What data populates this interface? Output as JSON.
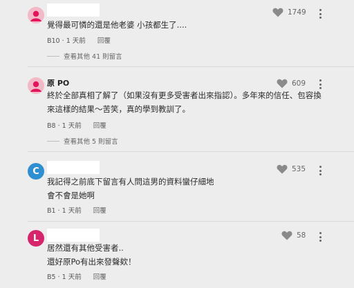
{
  "comments": [
    {
      "name": "",
      "text_lines": [
        "覺得最可憐的還是他老婆 小孩都生了...."
      ],
      "floor": "B10",
      "time": "1 天前",
      "reply": "回覆",
      "likes": "1749",
      "more_replies": "查看其他 41 則留言",
      "avatar_color": "#f3b9c6"
    },
    {
      "name": "原 PO",
      "text_lines": [
        "終於全部真相了解了（如果沒有更多受害者出來指認）。多年來的信任、包容換",
        "來這樣的結果～苦笑，真的學到教訓了。"
      ],
      "floor": "B8",
      "time": "1 天前",
      "reply": "回覆",
      "likes": "609",
      "more_replies": "查看其他 5 則留言",
      "avatar_color": "#f3b9c6"
    },
    {
      "name": "",
      "avatar_letter": "C",
      "text_lines": [
        "我記得之前底下留言有人問這男的資料蠻仔細地",
        "會不會是她啊"
      ],
      "floor": "B1",
      "time": "1 天前",
      "reply": "回覆",
      "likes": "535",
      "avatar_color": "#2f8fd0"
    },
    {
      "name": "",
      "avatar_letter": "L",
      "text_lines": [
        "居然還有其他受害者..",
        "還好原Po有出來發聲欸！"
      ],
      "floor": "B5",
      "time": "1 天前",
      "reply": "回覆",
      "likes": "58",
      "avatar_color": "#d6256b"
    }
  ],
  "meta_separator": "·"
}
